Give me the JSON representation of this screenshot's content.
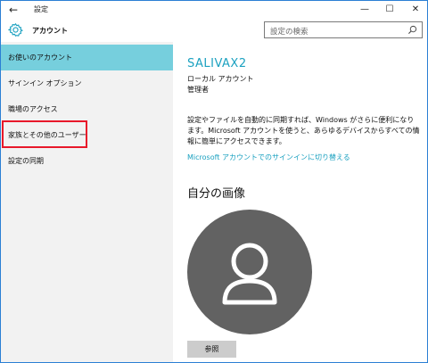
{
  "window": {
    "back_glyph": "←",
    "title": "設定",
    "controls": {
      "minimize": "—",
      "maximize": "☐",
      "close": "✕"
    }
  },
  "header": {
    "title": "アカウント",
    "icon": "gear-icon",
    "search": {
      "placeholder": "設定の検索",
      "icon": "search-icon"
    }
  },
  "sidebar": {
    "items": [
      {
        "label": "お使いのアカウント",
        "active": true
      },
      {
        "label": "サインイン オプション",
        "active": false
      },
      {
        "label": "職場のアクセス",
        "active": false
      },
      {
        "label": "家族とその他のユーザー",
        "active": false,
        "highlighted": true
      },
      {
        "label": "設定の同期",
        "active": false
      }
    ]
  },
  "main": {
    "user_name": "SALIVAX2",
    "account_type": "ローカル アカウント",
    "role": "管理者",
    "description": "設定やファイルを自動的に同期すれば、Windows がさらに便利になります。Microsoft アカウントを使うと、あらゆるデバイスからすべての情報に簡単にアクセスできます。",
    "link": "Microsoft アカウントでのサインインに切り替える",
    "picture_heading": "自分の画像",
    "browse_button": "参照"
  },
  "colors": {
    "accent": "#1ba1c0",
    "active_item": "#76cfdd",
    "highlight_border": "#e8182a",
    "avatar_bg": "#626262"
  }
}
